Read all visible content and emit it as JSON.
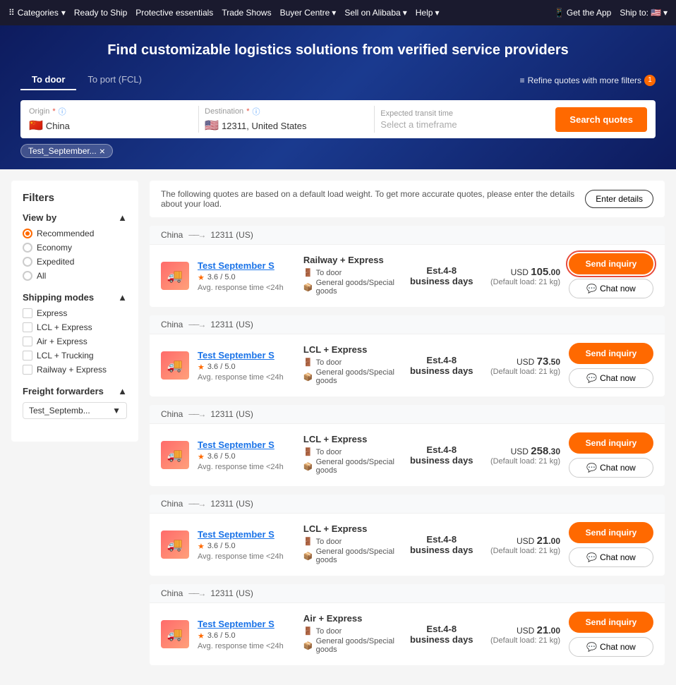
{
  "topnav": {
    "items": [
      {
        "label": "Categories",
        "hasDropdown": true
      },
      {
        "label": "Ready to Ship"
      },
      {
        "label": "Protective essentials"
      },
      {
        "label": "Trade Shows"
      },
      {
        "label": "Buyer Centre",
        "hasDropdown": true
      },
      {
        "label": "Sell on Alibaba",
        "hasDropdown": true
      },
      {
        "label": "Help",
        "hasDropdown": true
      }
    ],
    "right": [
      {
        "label": "Get the App"
      },
      {
        "label": "Ship to:"
      }
    ]
  },
  "hero": {
    "title": "Find customizable logistics solutions from verified service providers",
    "tabs": [
      {
        "label": "To door",
        "active": true
      },
      {
        "label": "To port (FCL)",
        "active": false
      }
    ],
    "refine_label": "Refine quotes with more filters",
    "refine_count": "1",
    "search_button": "Search quotes",
    "origin": {
      "label": "Origin",
      "flag": "🇨🇳",
      "value": "China"
    },
    "destination": {
      "label": "Destination",
      "flag": "🇺🇸",
      "value": "12311, United States"
    },
    "transit_time": {
      "label": "Expected transit time",
      "placeholder": "Select a timeframe"
    },
    "tag": "Test_September...",
    "tag_close": "×"
  },
  "filters": {
    "title": "Filters",
    "view_by": {
      "label": "View by",
      "options": [
        {
          "label": "Recommended",
          "selected": true
        },
        {
          "label": "Economy",
          "selected": false
        },
        {
          "label": "Expedited",
          "selected": false
        },
        {
          "label": "All",
          "selected": false
        }
      ]
    },
    "shipping_modes": {
      "label": "Shipping modes",
      "options": [
        {
          "label": "Express"
        },
        {
          "label": "LCL + Express"
        },
        {
          "label": "Air + Express"
        },
        {
          "label": "LCL + Trucking"
        },
        {
          "label": "Railway + Express"
        }
      ]
    },
    "freight_forwarders": {
      "label": "Freight forwarders",
      "value": "Test_Septemb...",
      "dropdown_arrow": "▼"
    }
  },
  "info_banner": {
    "text": "The following quotes are based on a default load weight. To get more accurate quotes, please enter the details about your load.",
    "button": "Enter details"
  },
  "quotes": [
    {
      "origin": "China",
      "destination": "12311 (US)",
      "provider_name": "Test September S",
      "rating": "3.6",
      "rating_max": "5.0",
      "response_time": "Avg. response time <24h",
      "shipping_type": "Railway + Express",
      "door_type": "To door",
      "goods": "General goods/Special goods",
      "transit": "Est.4-8 business days",
      "price_currency": "USD",
      "price_whole": "105",
      "price_decimal": ".00",
      "price_note": "(Default load: 21 kg)",
      "send_inquiry": "Send inquiry",
      "chat_now": "Chat now",
      "highlighted": true
    },
    {
      "origin": "China",
      "destination": "12311 (US)",
      "provider_name": "Test September S",
      "rating": "3.6",
      "rating_max": "5.0",
      "response_time": "Avg. response time <24h",
      "shipping_type": "LCL + Express",
      "door_type": "To door",
      "goods": "General goods/Special goods",
      "transit": "Est.4-8 business days",
      "price_currency": "USD",
      "price_whole": "73",
      "price_decimal": ".50",
      "price_note": "(Default load: 21 kg)",
      "send_inquiry": "Send inquiry",
      "chat_now": "Chat now",
      "highlighted": false
    },
    {
      "origin": "China",
      "destination": "12311 (US)",
      "provider_name": "Test September S",
      "rating": "3.6",
      "rating_max": "5.0",
      "response_time": "Avg. response time <24h",
      "shipping_type": "LCL + Express",
      "door_type": "To door",
      "goods": "General goods/Special goods",
      "transit": "Est.4-8 business days",
      "price_currency": "USD",
      "price_whole": "258",
      "price_decimal": ".30",
      "price_note": "(Default load: 21 kg)",
      "send_inquiry": "Send inquiry",
      "chat_now": "Chat now",
      "highlighted": false
    },
    {
      "origin": "China",
      "destination": "12311 (US)",
      "provider_name": "Test September S",
      "rating": "3.6",
      "rating_max": "5.0",
      "response_time": "Avg. response time <24h",
      "shipping_type": "LCL + Express",
      "door_type": "To door",
      "goods": "General goods/Special goods",
      "transit": "Est.4-8 business days",
      "price_currency": "USD",
      "price_whole": "21",
      "price_decimal": ".00",
      "price_note": "(Default load: 21 kg)",
      "send_inquiry": "Send inquiry",
      "chat_now": "Chat now",
      "highlighted": false
    },
    {
      "origin": "China",
      "destination": "12311 (US)",
      "provider_name": "Test September S",
      "rating": "3.6",
      "rating_max": "5.0",
      "response_time": "Avg. response time <24h",
      "shipping_type": "Air + Express",
      "door_type": "To door",
      "goods": "General goods/Special goods",
      "transit": "Est.4-8 business days",
      "price_currency": "USD",
      "price_whole": "21",
      "price_decimal": ".00",
      "price_note": "(Default load: 21 kg)",
      "send_inquiry": "Send inquiry",
      "chat_now": "Chat now",
      "highlighted": false
    }
  ]
}
